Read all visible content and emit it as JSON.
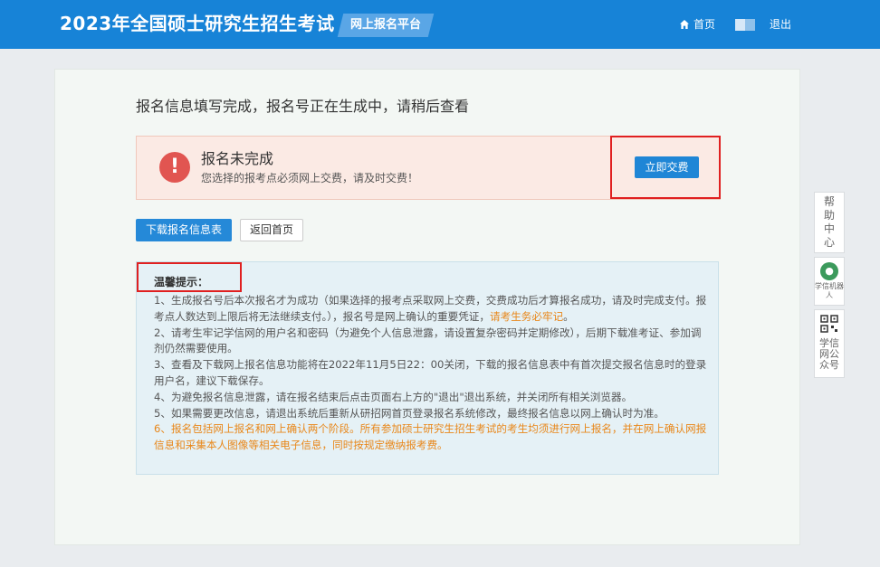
{
  "header": {
    "title": "2023年全国硕士研究生招生考试",
    "platform_tag": "网上报名平台",
    "home_label": "首页",
    "logout_label": "退出",
    "icons": [
      "home-icon",
      "toggle-icon"
    ]
  },
  "main": {
    "status_heading": "报名信息填写完成，报名号正在生成中，请稍后查看",
    "alert": {
      "icon": "!",
      "title": "报名未完成",
      "description": "您选择的报考点必须网上交费，请及时交费！",
      "pay_button": "立即交费"
    },
    "download_button": "下载报名信息表",
    "return_home_button": "返回首页",
    "tips": {
      "title": "温馨提示：",
      "item1": "1、生成报名号后本次报名才为成功（如果选择的报考点采取网上交费，交费成功后才算报名成功，请及时完成支付。报考点人数达到上限后将无法继续支付。），报名号是网上确认的重要凭证，",
      "item1_highlight": "请考生务必牢记",
      "item1_end": "。",
      "item2": "2、请考生牢记学信网的用户名和密码（为避免个人信息泄露，请设置复杂密码并定期修改），后期下载准考证、参加调剂仍然需要使用。",
      "item3": "3、查看及下载网上报名信息功能将在2022年11月5日22：00关闭，下载的报名信息表中有首次提交报名信息时的登录用户名，建议下载保存。",
      "item4": "4、为避免报名信息泄露，请在报名结束后点击页面右上方的\"退出\"退出系统，并关闭所有相关浏览器。",
      "item5": "5、如果需要更改信息，请退出系统后重新从研招网首页登录报名系统修改，最终报名信息以网上确认时为准。",
      "item6": "6、报名包括网上报名和网上确认两个阶段。所有参加硕士研究生招生考试的考生均须进行网上报名，并在网上确认网报信息和采集本人图像等相关电子信息，同时按规定缴纳报考费。"
    }
  },
  "sidebar": {
    "help_chars": [
      "帮",
      "助",
      "中",
      "心"
    ],
    "robot_label": "学信机器人",
    "wechat_label": "学信网公众号"
  },
  "colors": {
    "header_bg": "#1783d7",
    "primary_button": "#1f86d6",
    "alert_bg": "#fbeae4",
    "alert_icon": "#e15551",
    "tips_bg": "#e5f1f6",
    "highlight": "#e8871a",
    "annotation_box": "#e02020"
  }
}
